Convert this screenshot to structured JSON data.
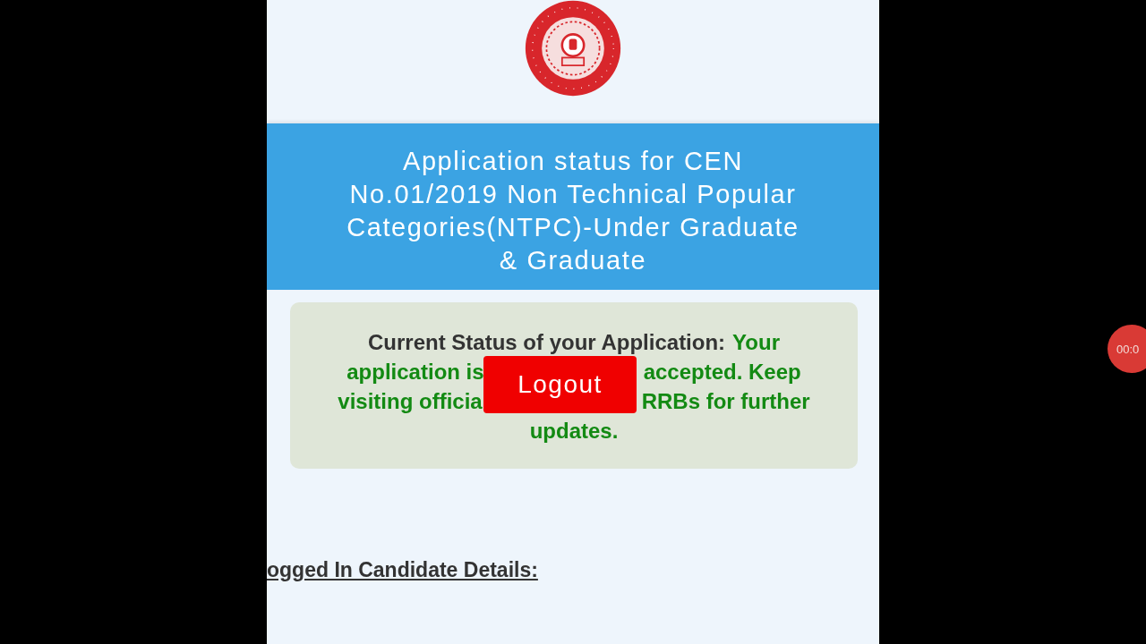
{
  "header": {
    "title": "Application status for CEN No.01/2019 Non Technical Popular Categories(NTPC)-Under Graduate & Graduate"
  },
  "status_card": {
    "label": "Current Status of your Application:",
    "lines": [
      {
        "left": "Your"
      },
      {
        "left": "application is",
        "right": "accepted. Keep"
      },
      {
        "left": "visiting officia",
        "right": "RRBs for further"
      },
      {
        "left": "updates."
      }
    ]
  },
  "logout_button": {
    "label": "Logout"
  },
  "section_heading": "ogged In Candidate Details:",
  "recording_badge": {
    "time": "00:0"
  }
}
